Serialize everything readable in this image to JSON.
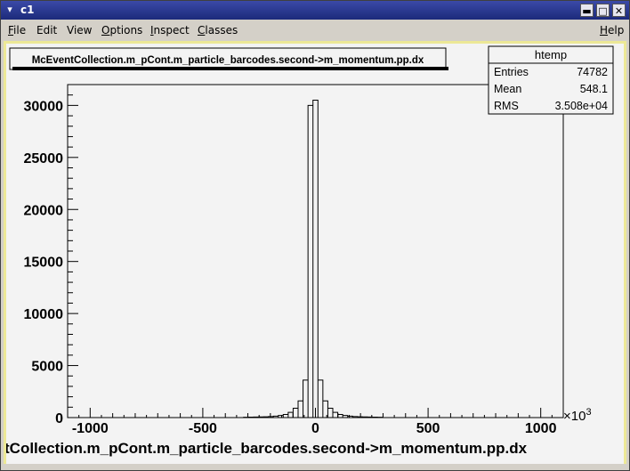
{
  "window": {
    "title": "c1",
    "menu_icon": "chevron-down-icon",
    "controls": [
      {
        "name": "minimize",
        "glyph": "▬"
      },
      {
        "name": "maximize",
        "glyph": "□"
      },
      {
        "name": "close",
        "glyph": "✕"
      }
    ]
  },
  "menubar": {
    "items": [
      {
        "mnemonic": "F",
        "rest": "ile"
      },
      {
        "mnemonic": "",
        "rest": "Edit"
      },
      {
        "mnemonic": "",
        "rest": "View"
      },
      {
        "mnemonic": "O",
        "rest": "ptions"
      },
      {
        "mnemonic": "I",
        "rest": "nspect"
      },
      {
        "mnemonic": "C",
        "rest": "lasses"
      }
    ],
    "help": {
      "mnemonic": "H",
      "rest": "elp"
    }
  },
  "plot": {
    "title_box": "McEventCollection.m_pCont.m_particle_barcodes.second->m_momentum.pp.dx",
    "stats": {
      "name": "htemp",
      "rows": [
        {
          "label": "Entries",
          "value": "74782"
        },
        {
          "label": "Mean",
          "value": "548.1"
        },
        {
          "label": "RMS",
          "value": "3.508e+04"
        }
      ]
    },
    "x_multiplier_base": "×10",
    "x_multiplier_exp": "3",
    "xlabel_visible": "tCollection.m_pCont.m_particle_barcodes.second->m_momentum.pp.dx"
  },
  "chart_data": {
    "type": "bar",
    "title": "McEventCollection.m_pCont.m_particle_barcodes.second->m_momentum.pp.dx",
    "xlabel": "McEventCollection.m_pCont.m_particle_barcodes.second->m_momentum.pp.dx",
    "ylabel": "",
    "xlim": [
      -1100,
      1100
    ],
    "ylim": [
      0,
      32000
    ],
    "x_ticks": [
      -1000,
      -500,
      0,
      500,
      1000
    ],
    "y_ticks": [
      0,
      5000,
      10000,
      15000,
      20000,
      25000,
      30000
    ],
    "x_tick_labels": [
      "-1000",
      "-500",
      "0",
      "500",
      "1000"
    ],
    "y_tick_labels": [
      "0",
      "5000",
      "10000",
      "15000",
      "20000",
      "25000",
      "30000"
    ],
    "x_unit_multiplier": "×10^3",
    "bin_width": 22,
    "bins": [
      {
        "x": -308,
        "y": 30
      },
      {
        "x": -286,
        "y": 40
      },
      {
        "x": -264,
        "y": 50
      },
      {
        "x": -242,
        "y": 60
      },
      {
        "x": -220,
        "y": 80
      },
      {
        "x": -198,
        "y": 100
      },
      {
        "x": -176,
        "y": 140
      },
      {
        "x": -154,
        "y": 200
      },
      {
        "x": -132,
        "y": 300
      },
      {
        "x": -110,
        "y": 500
      },
      {
        "x": -88,
        "y": 900
      },
      {
        "x": -66,
        "y": 1600
      },
      {
        "x": -44,
        "y": 3600
      },
      {
        "x": -22,
        "y": 30000
      },
      {
        "x": 0,
        "y": 30500
      },
      {
        "x": 22,
        "y": 3600
      },
      {
        "x": 44,
        "y": 1600
      },
      {
        "x": 66,
        "y": 900
      },
      {
        "x": 88,
        "y": 500
      },
      {
        "x": 110,
        "y": 300
      },
      {
        "x": 132,
        "y": 200
      },
      {
        "x": 154,
        "y": 140
      },
      {
        "x": 176,
        "y": 100
      },
      {
        "x": 198,
        "y": 80
      },
      {
        "x": 220,
        "y": 60
      },
      {
        "x": 242,
        "y": 50
      },
      {
        "x": 264,
        "y": 40
      },
      {
        "x": 286,
        "y": 30
      }
    ],
    "grid": false,
    "legend": "top-right stats box"
  }
}
